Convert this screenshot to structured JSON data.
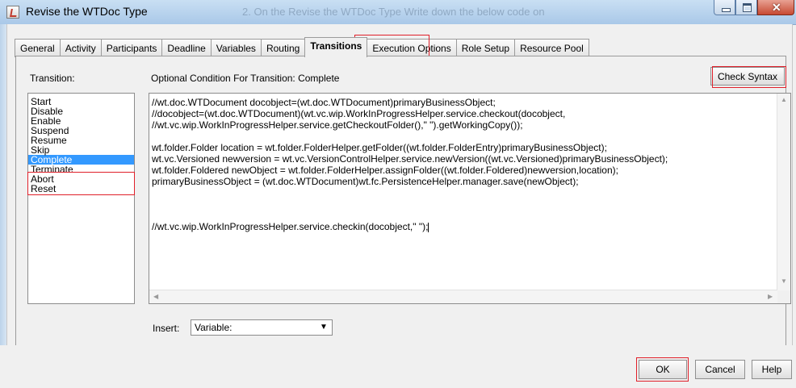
{
  "window": {
    "title": "Revise the WTDoc Type",
    "background_text": "2. On the Revise the WTDoc Type Write down the below code on"
  },
  "tabs": [
    {
      "label": "General"
    },
    {
      "label": "Activity"
    },
    {
      "label": "Participants"
    },
    {
      "label": "Deadline"
    },
    {
      "label": "Variables"
    },
    {
      "label": "Routing"
    },
    {
      "label": "Transitions",
      "active": true
    },
    {
      "label": "Execution Options"
    },
    {
      "label": "Role Setup"
    },
    {
      "label": "Resource Pool"
    }
  ],
  "transition_panel": {
    "label": "Transition:",
    "items": [
      "Start",
      "Disable",
      "Enable",
      "Suspend",
      "Resume",
      "Skip",
      "Complete",
      "Terminate",
      "Abort",
      "Reset"
    ],
    "selected": "Complete"
  },
  "condition": {
    "label": "Optional Condition For Transition: Complete",
    "check_syntax_label": "Check Syntax",
    "code_lines": [
      "//wt.doc.WTDocument docobject=(wt.doc.WTDocument)primaryBusinessObject;",
      "//docobject=(wt.doc.WTDocument)(wt.vc.wip.WorkInProgressHelper.service.checkout(docobject,",
      "//wt.vc.wip.WorkInProgressHelper.service.getCheckoutFolder(),\" \").getWorkingCopy());",
      "",
      "wt.folder.Folder location = wt.folder.FolderHelper.getFolder((wt.folder.FolderEntry)primaryBusinessObject);",
      "wt.vc.Versioned newversion = wt.vc.VersionControlHelper.service.newVersion((wt.vc.Versioned)primaryBusinessObject);",
      "wt.folder.Foldered newObject = wt.folder.FolderHelper.assignFolder((wt.folder.Foldered)newversion,location);",
      "primaryBusinessObject = (wt.doc.WTDocument)wt.fc.PersistenceHelper.manager.save(newObject);",
      "",
      "",
      "",
      "//wt.vc.wip.WorkInProgressHelper.service.checkin(docobject,\" \");"
    ]
  },
  "insert": {
    "label": "Insert:",
    "value": "Variable:"
  },
  "buttons": {
    "ok": "OK",
    "cancel": "Cancel",
    "help": "Help"
  },
  "colors": {
    "highlight_box": "#e0202a",
    "selection": "#3399ff"
  }
}
